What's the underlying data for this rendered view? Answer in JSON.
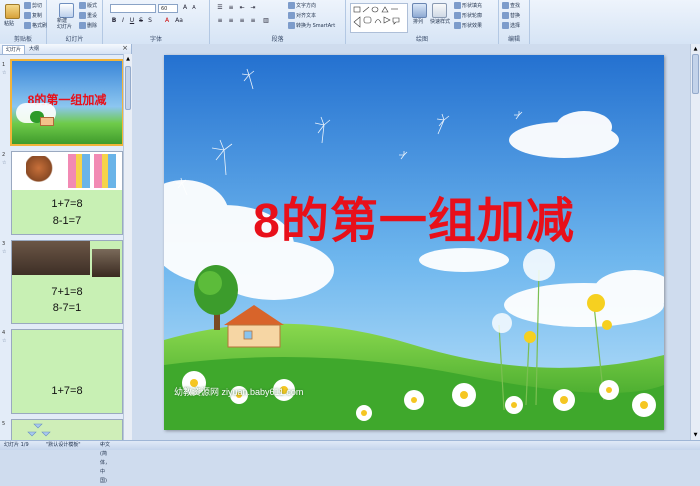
{
  "ribbon": {
    "clipboard": {
      "label": "剪贴板",
      "paste": "粘贴",
      "cut": "剪切",
      "copy": "复制",
      "format_painter": "格式刷"
    },
    "slides": {
      "label": "幻灯片",
      "new_slide": "新建\n幻灯片",
      "layout": "版式",
      "reset": "重设",
      "delete": "删除"
    },
    "font": {
      "label": "字体",
      "font_name": "",
      "font_size": "60"
    },
    "paragraph": {
      "label": "段落",
      "text_direction": "文字方向",
      "align_text": "对齐文本",
      "smartart": "转换为 SmartArt"
    },
    "drawing": {
      "label": "绘图",
      "arrange": "排列",
      "quick_styles": "快速样式",
      "shape_fill": "形状填充",
      "shape_outline": "形状轮廓",
      "shape_effects": "形状效果"
    },
    "editing": {
      "label": "编辑",
      "find": "查找",
      "replace": "替换",
      "select": "选择"
    }
  },
  "panel": {
    "tab_slides": "幻灯片",
    "tab_outline": "大纲",
    "slides": [
      {
        "num": "1",
        "title": "8的第一组加减"
      },
      {
        "num": "2",
        "line1": "1+7=8",
        "line2": "8-1=7"
      },
      {
        "num": "3",
        "line1": "7+1=8",
        "line2": "8-7=1"
      },
      {
        "num": "4",
        "line1": "1+7=8"
      },
      {
        "num": "5"
      }
    ]
  },
  "slide": {
    "title_num": "8",
    "title_text": "的第一组加减",
    "watermark": "幼教资源网 ziyuan.baby611.com"
  },
  "status": {
    "slide_info": "幻灯片 1/9",
    "theme": "\"默认设计模板\"",
    "language": "中文(简体，中国)"
  },
  "colors": {
    "title": "#e8101a",
    "sky_top": "#2f7fd6",
    "grass": "#5cc23a",
    "ribbon": "#d6e4f5"
  }
}
